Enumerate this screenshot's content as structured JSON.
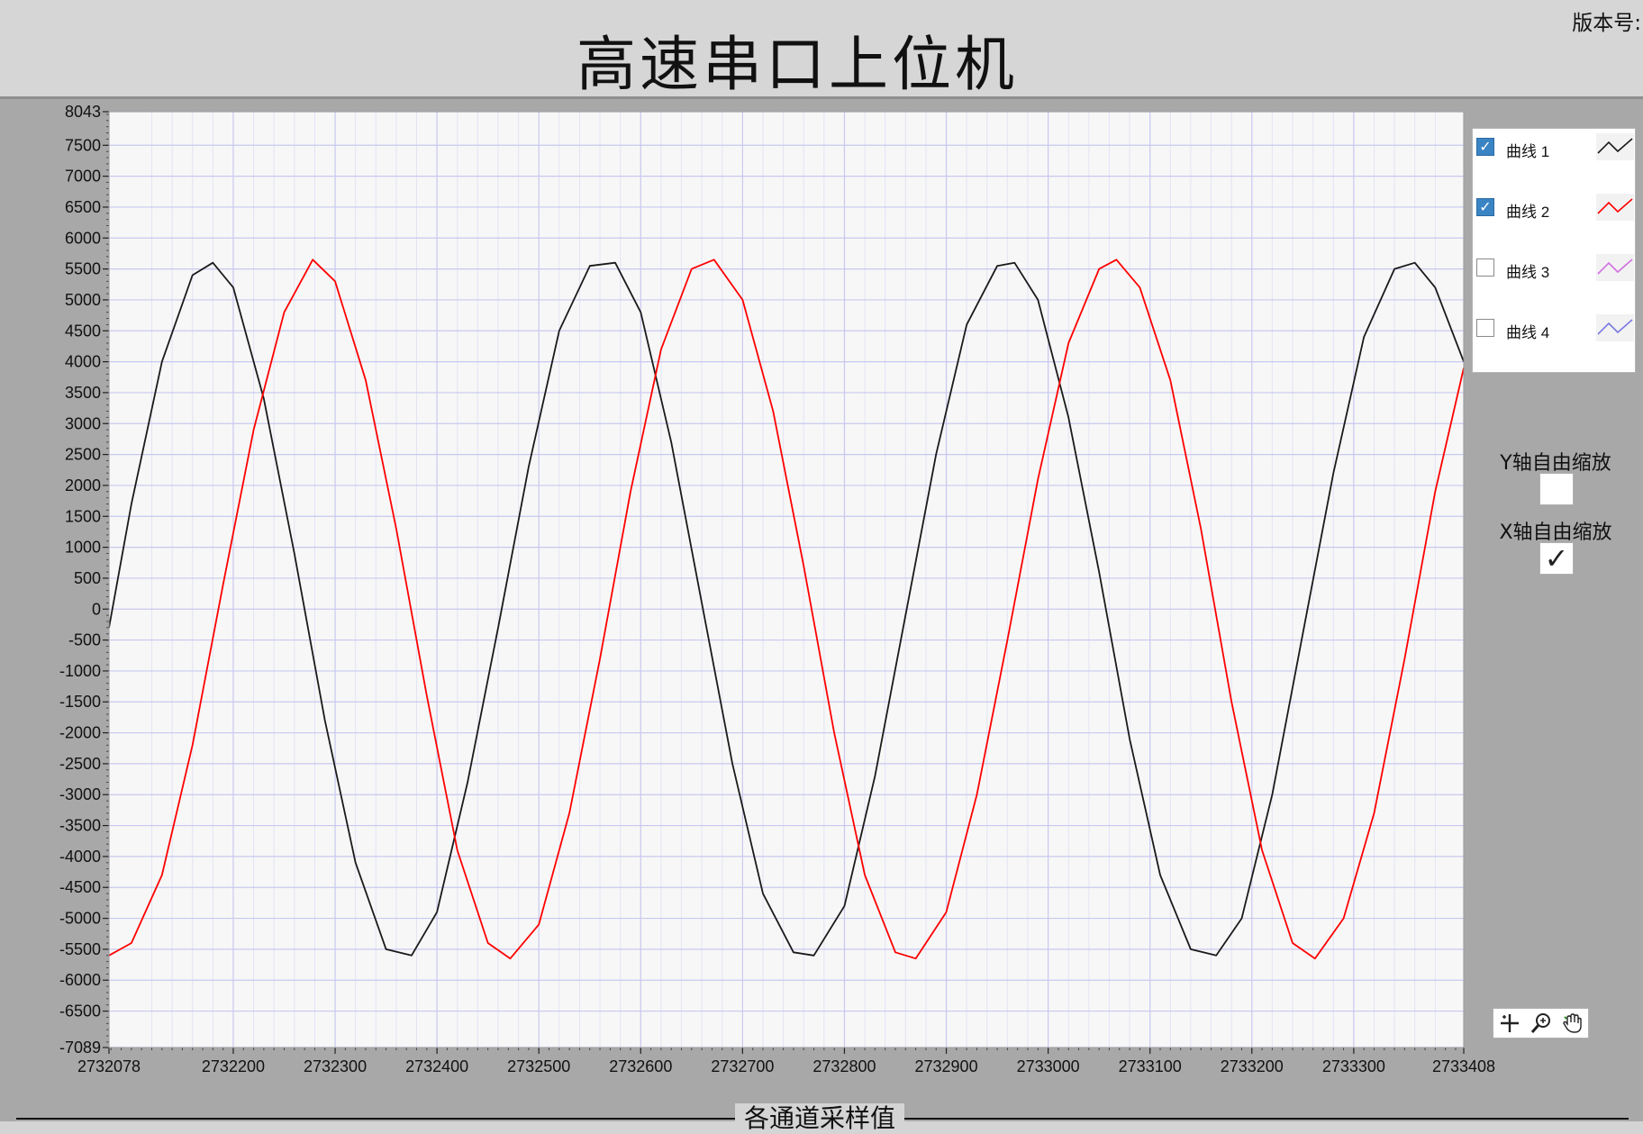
{
  "header": {
    "title": "高速串口上位机",
    "version_label": "版本号:"
  },
  "legend": {
    "items": [
      {
        "label": "曲线 1",
        "checked": true,
        "color": "#1a1a1a"
      },
      {
        "label": "曲线 2",
        "checked": true,
        "color": "#ff0000"
      },
      {
        "label": "曲线 3",
        "checked": false,
        "color": "#d070e0"
      },
      {
        "label": "曲线 4",
        "checked": false,
        "color": "#7a7ae0"
      }
    ]
  },
  "controls": {
    "y_autoscale_label": "Y轴自由缩放",
    "y_autoscale_checked": false,
    "x_autoscale_label": "X轴自由缩放",
    "x_autoscale_checked": true,
    "check_glyph": "✓"
  },
  "tools": [
    "cursor-move-icon",
    "zoom-icon",
    "pan-hand-icon"
  ],
  "bottom_section": {
    "label": "各通道采样值"
  },
  "chart_data": {
    "type": "line",
    "x_range": [
      2732078,
      2733408
    ],
    "y_range": [
      -7089,
      8043
    ],
    "x_ticks": [
      2732078,
      2732200,
      2732300,
      2732400,
      2732500,
      2732600,
      2732700,
      2732800,
      2732900,
      2733000,
      2733100,
      2733200,
      2733300,
      2733408
    ],
    "y_ticks": [
      8043,
      7500,
      7000,
      6500,
      6000,
      5500,
      5000,
      4500,
      4000,
      3500,
      3000,
      2500,
      2000,
      1500,
      1000,
      500,
      0,
      -500,
      -1000,
      -1500,
      -2000,
      -2500,
      -3000,
      -3500,
      -4000,
      -4500,
      -5000,
      -5500,
      -6000,
      -6500,
      -7089
    ],
    "grid": true,
    "plot_background": "#f7f7f7",
    "grid_color": "#c8c8f0",
    "series": [
      {
        "name": "曲线 1",
        "color": "#1a1a1a",
        "x": [
          2732078,
          2732100,
          2732130,
          2732160,
          2732180,
          2732200,
          2732230,
          2732260,
          2732290,
          2732320,
          2732350,
          2732375,
          2732400,
          2732430,
          2732460,
          2732490,
          2732520,
          2732550,
          2732575,
          2732600,
          2732630,
          2732660,
          2732690,
          2732720,
          2732750,
          2732770,
          2732800,
          2732830,
          2732860,
          2732890,
          2732920,
          2732950,
          2732967,
          2732990,
          2733020,
          2733050,
          2733080,
          2733110,
          2733140,
          2733165,
          2733190,
          2733220,
          2733250,
          2733280,
          2733310,
          2733340,
          2733360,
          2733380,
          2733408
        ],
        "y": [
          -300,
          1700,
          4000,
          5400,
          5600,
          5200,
          3400,
          900,
          -1800,
          -4100,
          -5500,
          -5600,
          -4900,
          -2800,
          -300,
          2300,
          4500,
          5550,
          5600,
          4800,
          2700,
          100,
          -2500,
          -4600,
          -5550,
          -5600,
          -4800,
          -2700,
          -100,
          2500,
          4600,
          5550,
          5600,
          5000,
          3100,
          600,
          -2100,
          -4300,
          -5500,
          -5600,
          -5000,
          -3000,
          -400,
          2200,
          4400,
          5500,
          5600,
          5200,
          4000
        ]
      },
      {
        "name": "曲线 2",
        "color": "#ff0000",
        "x": [
          2732078,
          2732100,
          2732130,
          2732160,
          2732190,
          2732220,
          2732250,
          2732278,
          2732300,
          2732330,
          2732360,
          2732390,
          2732420,
          2732450,
          2732472,
          2732500,
          2732530,
          2732560,
          2732590,
          2732620,
          2732650,
          2732672,
          2732700,
          2732730,
          2732760,
          2732790,
          2732820,
          2732850,
          2732870,
          2732900,
          2732930,
          2732960,
          2732990,
          2733020,
          2733050,
          2733067,
          2733090,
          2733120,
          2733150,
          2733180,
          2733210,
          2733240,
          2733262,
          2733290,
          2733320,
          2733350,
          2733380,
          2733408
        ],
        "y": [
          -5600,
          -5400,
          -4300,
          -2200,
          400,
          2900,
          4800,
          5650,
          5300,
          3700,
          1300,
          -1400,
          -3900,
          -5400,
          -5650,
          -5100,
          -3300,
          -800,
          1900,
          4200,
          5500,
          5650,
          5000,
          3200,
          700,
          -2000,
          -4300,
          -5550,
          -5650,
          -4900,
          -3000,
          -500,
          2100,
          4300,
          5500,
          5650,
          5200,
          3700,
          1300,
          -1500,
          -3900,
          -5400,
          -5650,
          -5000,
          -3300,
          -800,
          1900,
          3900
        ]
      }
    ]
  }
}
